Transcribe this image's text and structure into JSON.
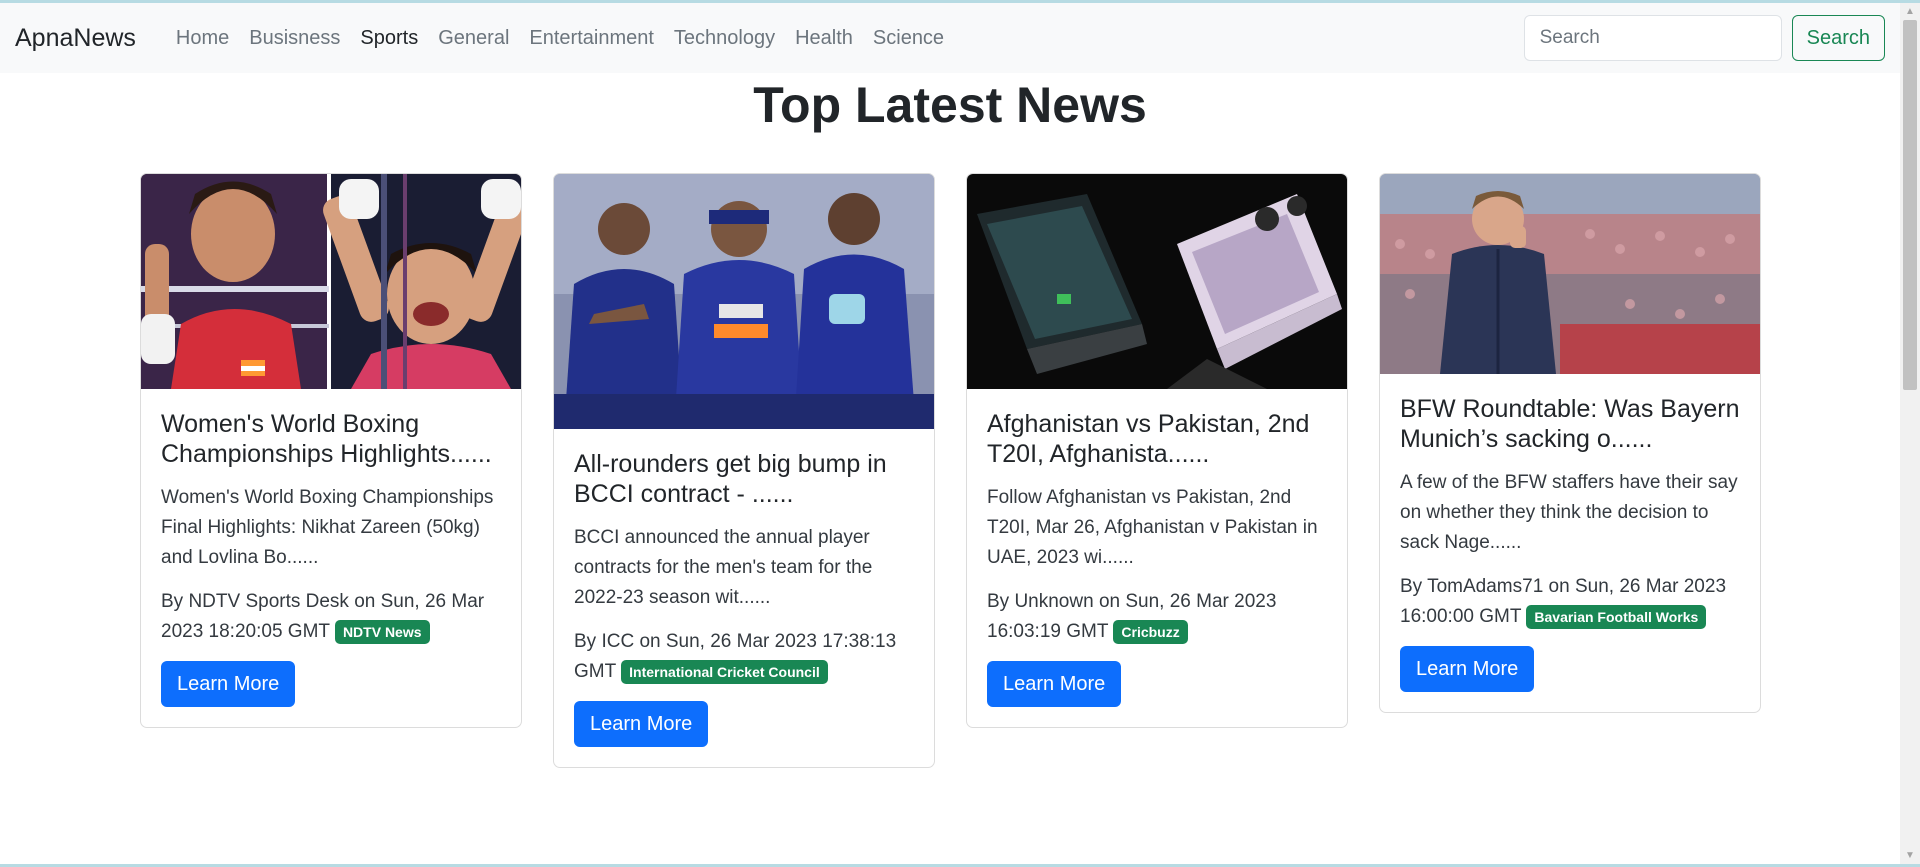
{
  "navbar": {
    "brand": "ApnaNews",
    "links": [
      {
        "label": "Home",
        "active": false
      },
      {
        "label": "Busisness",
        "active": false
      },
      {
        "label": "Sports",
        "active": true
      },
      {
        "label": "General",
        "active": false
      },
      {
        "label": "Entertainment",
        "active": false
      },
      {
        "label": "Technology",
        "active": false
      },
      {
        "label": "Health",
        "active": false
      },
      {
        "label": "Science",
        "active": false
      }
    ],
    "search_placeholder": "Search",
    "search_button": "Search"
  },
  "page": {
    "title": "Top Latest News"
  },
  "cards": [
    {
      "title": "Women's World Boxing Championships Highlights......",
      "text": "Women's World Boxing Championships Final Highlights: Nikhat Zareen (50kg) and Lovlina Bo......",
      "meta": "By NDTV Sports Desk on Sun, 26 Mar 2023 18:20:05 GMT",
      "source": "NDTV News",
      "button": "Learn More",
      "image": "boxing"
    },
    {
      "title": "All-rounders get big bump in BCCI contract - ......",
      "text": "BCCI announced the annual player contracts for the men's team for the 2022-23 season wit......",
      "meta": "By ICC on Sun, 26 Mar 2023 17:38:13 GMT",
      "source": "International Cricket Council",
      "button": "Learn More",
      "image": "cricket"
    },
    {
      "title": "Afghanistan vs Pakistan, 2nd T20I, Afghanista......",
      "text": "Follow Afghanistan vs Pakistan, 2nd T20I, Mar 26, Afghanistan v Pakistan in UAE, 2023 wi......",
      "meta": "By Unknown on Sun, 26 Mar 2023 16:03:19 GMT",
      "source": "Cricbuzz",
      "button": "Learn More",
      "image": "phone"
    },
    {
      "title": "BFW Roundtable: Was Bayern Munich’s sacking o......",
      "text": "A few of the BFW staffers have their say on whether they think the decision to sack Nage......",
      "meta": "By TomAdams71 on Sun, 26 Mar 2023 16:00:00 GMT",
      "source": "Bavarian Football Works",
      "button": "Learn More",
      "image": "football"
    }
  ],
  "colors": {
    "primary": "#0d6efd",
    "success": "#198754",
    "navbar_bg": "#f8f9fa"
  }
}
